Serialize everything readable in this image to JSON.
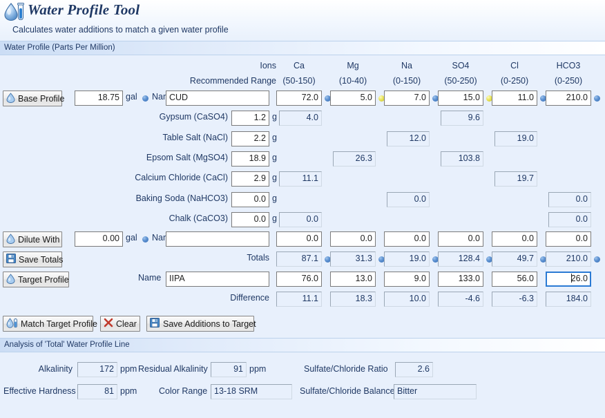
{
  "app": {
    "title": "Water Profile Tool",
    "subtitle": "Calculates water additions to match a given water profile",
    "logo_icon": "water-droplet-test-tube-icon"
  },
  "sections": {
    "water_profile": "Water Profile (Parts Per Million)",
    "analysis": "Analysis of 'Total' Water Profile Line"
  },
  "grid": {
    "ions_label": "Ions",
    "recommended_range_label": "Recommended Range",
    "columns": [
      {
        "name": "Ca",
        "range": "(50-150)"
      },
      {
        "name": "Mg",
        "range": "(10-40)"
      },
      {
        "name": "Na",
        "range": "(0-150)"
      },
      {
        "name": "SO4",
        "range": "(50-250)"
      },
      {
        "name": "Cl",
        "range": "(0-250)"
      },
      {
        "name": "HCO3",
        "range": "(0-250)"
      }
    ]
  },
  "base_profile": {
    "button_label": "Base Profile",
    "button_icon": "water-droplet-icon",
    "volume": "18.75",
    "volume_unit": "gal",
    "volume_dot": "blue",
    "name_label": "Name",
    "name": "CUD",
    "values": [
      "72.0",
      "5.0",
      "7.0",
      "15.0",
      "11.0",
      "210.0"
    ],
    "dots": [
      "blue",
      "yellow",
      "blue",
      "yellow",
      "blue",
      "blue"
    ]
  },
  "additions": [
    {
      "label": "Gypsum (CaSO4)",
      "grams": "1.2",
      "unit": "g",
      "values": [
        "4.0",
        "",
        "",
        "9.6",
        "",
        ""
      ]
    },
    {
      "label": "Table Salt (NaCl)",
      "grams": "2.2",
      "unit": "g",
      "values": [
        "",
        "",
        "12.0",
        "",
        "19.0",
        ""
      ]
    },
    {
      "label": "Epsom Salt (MgSO4)",
      "grams": "18.9",
      "unit": "g",
      "values": [
        "",
        "26.3",
        "",
        "103.8",
        "",
        ""
      ]
    },
    {
      "label": "Calcium Chloride (CaCl)",
      "grams": "2.9",
      "unit": "g",
      "values": [
        "11.1",
        "",
        "",
        "",
        "19.7",
        ""
      ]
    },
    {
      "label": "Baking Soda (NaHCO3)",
      "grams": "0.0",
      "unit": "g",
      "values": [
        "",
        "",
        "0.0",
        "",
        "",
        "0.0"
      ]
    },
    {
      "label": "Chalk (CaCO3)",
      "grams": "0.0",
      "unit": "g",
      "values": [
        "0.0",
        "",
        "",
        "",
        "",
        "0.0"
      ]
    }
  ],
  "dilute": {
    "button_label": "Dilute With",
    "button_icon": "water-droplet-icon",
    "volume": "0.00",
    "volume_unit": "gal",
    "volume_dot": "blue",
    "name_label": "Name",
    "name": "",
    "values": [
      "0.0",
      "0.0",
      "0.0",
      "0.0",
      "0.0",
      "0.0"
    ]
  },
  "totals": {
    "button_label": "Save Totals",
    "button_icon": "save-disk-icon",
    "row_label": "Totals",
    "values": [
      "87.1",
      "31.3",
      "19.0",
      "128.4",
      "49.7",
      "210.0"
    ],
    "dots": [
      "blue",
      "blue",
      "blue",
      "blue",
      "blue",
      "blue"
    ]
  },
  "target": {
    "button_label": "Target Profile",
    "button_icon": "water-droplet-icon",
    "name_label": "Name",
    "name": "IIPA",
    "values": [
      "76.0",
      "13.0",
      "9.0",
      "133.0",
      "56.0",
      "26.0"
    ],
    "focused_index": 5
  },
  "difference": {
    "row_label": "Difference",
    "values": [
      "11.1",
      "18.3",
      "10.0",
      "-4.6",
      "-6.3",
      "184.0"
    ]
  },
  "actions": [
    {
      "label": "Match Target Profile",
      "icon": "water-droplet-test-tube-icon"
    },
    {
      "label": "Clear",
      "icon": "red-x-icon"
    },
    {
      "label": "Save Additions to Target",
      "icon": "save-disk-icon"
    }
  ],
  "analysis": {
    "alkalinity_label": "Alkalinity",
    "alkalinity_value": "172",
    "alkalinity_unit": "ppm",
    "residual_alkalinity_label": "Residual Alkalinity",
    "residual_alkalinity_value": "91",
    "residual_alkalinity_unit": "ppm",
    "sulfate_chloride_ratio_label": "Sulfate/Chloride Ratio",
    "sulfate_chloride_ratio_value": "2.6",
    "effective_hardness_label": "Effective Hardness",
    "effective_hardness_value": "81",
    "effective_hardness_unit": "ppm",
    "color_range_label": "Color Range",
    "color_range_value": "13-18 SRM",
    "sulfate_chloride_balance_label": "Sulfate/Chloride Balance",
    "sulfate_chloride_balance_value": "Bitter"
  },
  "colors": {
    "background": "#e8f0fc",
    "text": "#1f3864",
    "dot_in_range": "#3a6fb4",
    "dot_warn": "#c9c32f",
    "focus_border": "#2a7ad4"
  }
}
